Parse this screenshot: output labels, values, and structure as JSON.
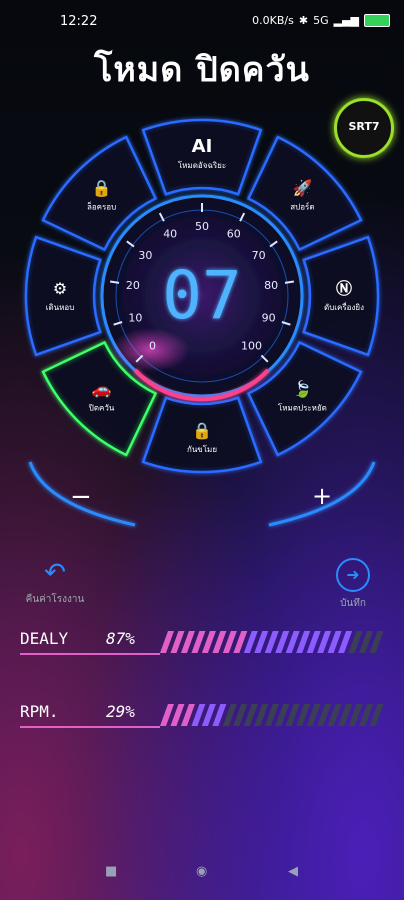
{
  "status": {
    "time": "12:22",
    "net": "0.0KB/s",
    "sig": "5G",
    "battery": "85"
  },
  "title": "โหมด ปิดควัน",
  "badge": {
    "text": "SRT7"
  },
  "gauge": {
    "value": "07",
    "ticks": [
      "0",
      "10",
      "20",
      "30",
      "40",
      "50",
      "60",
      "70",
      "80",
      "90",
      "100"
    ],
    "accent": "#1e9bff"
  },
  "segments": [
    {
      "label": "AI",
      "sub": "โหมดอัจฉริยะ"
    },
    {
      "label": "สปอร์ต"
    },
    {
      "label": "ดับเครื่องยิง"
    },
    {
      "label": "โหมดประหยัด"
    },
    {
      "label": "กันขโมย"
    },
    {
      "label": "ปิดควัน",
      "active": true
    },
    {
      "label": "เดินหอบ"
    },
    {
      "label": "ล็อครอบ"
    }
  ],
  "controls": {
    "minus": "−",
    "plus": "+"
  },
  "actions": {
    "reset": "คืนค่าโรงงาน",
    "save": "บันทึก"
  },
  "bars": [
    {
      "name": "DEALY",
      "value": "87%",
      "level": 0.87
    },
    {
      "name": "RPM.",
      "value": "29%",
      "level": 0.29
    }
  ],
  "colors": {
    "active": "#3dff6a",
    "frame": "#2a6cff"
  }
}
